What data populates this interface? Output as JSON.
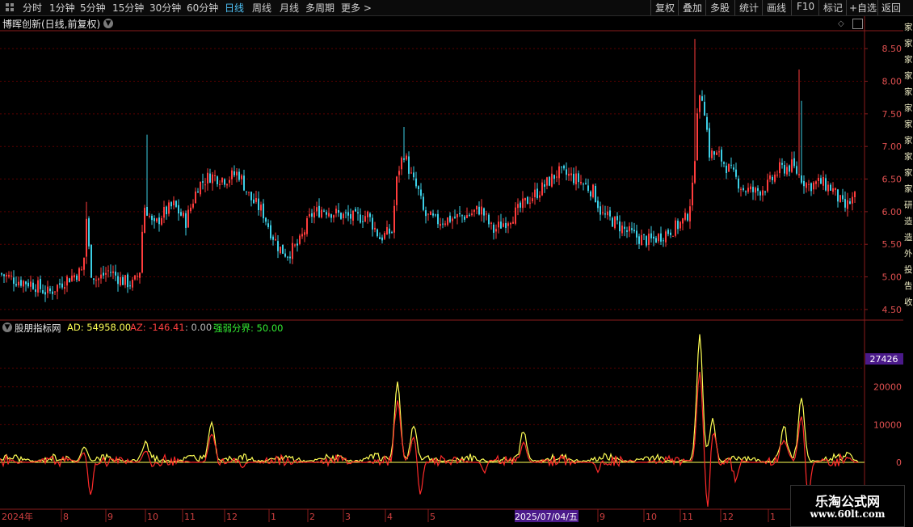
{
  "toolbar": {
    "periods": [
      "分时",
      "1分钟",
      "5分钟",
      "15分钟",
      "30分钟",
      "60分钟",
      "日线",
      "周线",
      "月线",
      "多周期",
      "更多 >"
    ],
    "active_period": "日线",
    "right_tools": [
      "复权",
      "叠加",
      "多股",
      "统计",
      "画线",
      "F10",
      "标记",
      "+自选",
      "返回"
    ]
  },
  "main_chart": {
    "title": "博晖创新(日线,前复权)",
    "price_axis_ticks": [
      "8.50",
      "8.00",
      "7.50",
      "7.00",
      "6.50",
      "6.00",
      "5.50",
      "5.00",
      "4.50"
    ]
  },
  "indicator": {
    "name": "股朋指标网",
    "ad_text": "AD: 54958.00",
    "az_text": "AZ: -146.41",
    "zero_text": ": 0.00",
    "qr_text": "强弱分界: 50.00",
    "axis_ticks": [
      "20000",
      "10000",
      "0"
    ],
    "highlight_value": "27426"
  },
  "date_axis": {
    "year_label": "2024年",
    "months": [
      "8",
      "9",
      "10",
      "11",
      "12",
      "1",
      "2",
      "3",
      "4",
      "5",
      "9",
      "10",
      "11",
      "12",
      "1"
    ],
    "cursor_date": "2025/07/04/五"
  },
  "right_side_text": "家家家家家家家家家家家研造造外投告收",
  "watermark": {
    "line1": "乐淘公式网",
    "line2": "www.60lt.com"
  },
  "colors": {
    "up": "#ff3c3c",
    "down": "#3ccfe6",
    "ad": "#ffff55",
    "az": "#ff2a2a",
    "grid": "#5a0000",
    "axis": "#8a1c1c"
  },
  "chart_data": {
    "type": "candlestick",
    "price_ylim": [
      4.35,
      8.75
    ],
    "price_trend": [
      [
        0,
        5.05
      ],
      [
        20,
        4.95
      ],
      [
        40,
        4.9
      ],
      [
        60,
        4.75
      ],
      [
        80,
        4.95
      ],
      [
        95,
        5.05
      ],
      [
        103,
        5.1
      ],
      [
        107,
        5.9
      ],
      [
        112,
        5.1
      ],
      [
        120,
        4.95
      ],
      [
        135,
        5.1
      ],
      [
        150,
        4.95
      ],
      [
        165,
        4.88
      ],
      [
        173,
        5.1
      ],
      [
        178,
        6.1
      ],
      [
        183,
        6.0
      ],
      [
        190,
        5.75
      ],
      [
        200,
        5.95
      ],
      [
        215,
        6.1
      ],
      [
        230,
        5.85
      ],
      [
        245,
        6.4
      ],
      [
        260,
        6.55
      ],
      [
        280,
        6.5
      ],
      [
        295,
        6.6
      ],
      [
        310,
        6.2
      ],
      [
        325,
        6.0
      ],
      [
        335,
        5.7
      ],
      [
        345,
        5.45
      ],
      [
        355,
        5.35
      ],
      [
        370,
        5.5
      ],
      [
        385,
        5.95
      ],
      [
        400,
        6.05
      ],
      [
        420,
        5.95
      ],
      [
        440,
        5.9
      ],
      [
        455,
        5.95
      ],
      [
        470,
        5.6
      ],
      [
        485,
        5.7
      ],
      [
        492,
        6.6
      ],
      [
        500,
        6.9
      ],
      [
        510,
        6.5
      ],
      [
        518,
        6.3
      ],
      [
        525,
        5.95
      ],
      [
        540,
        5.85
      ],
      [
        560,
        5.9
      ],
      [
        580,
        5.95
      ],
      [
        595,
        6.05
      ],
      [
        610,
        5.7
      ],
      [
        625,
        5.85
      ],
      [
        640,
        6.0
      ],
      [
        655,
        6.2
      ],
      [
        670,
        6.35
      ],
      [
        690,
        6.6
      ],
      [
        705,
        6.55
      ],
      [
        720,
        6.45
      ],
      [
        735,
        6.3
      ],
      [
        745,
        5.95
      ],
      [
        760,
        5.85
      ],
      [
        775,
        5.7
      ],
      [
        790,
        5.6
      ],
      [
        805,
        5.55
      ],
      [
        820,
        5.65
      ],
      [
        835,
        5.75
      ],
      [
        850,
        5.9
      ],
      [
        858,
        6.4
      ],
      [
        863,
        7.6
      ],
      [
        870,
        7.8
      ],
      [
        878,
        6.9
      ],
      [
        890,
        6.85
      ],
      [
        905,
        6.6
      ],
      [
        920,
        6.35
      ],
      [
        935,
        6.3
      ],
      [
        950,
        6.4
      ],
      [
        965,
        6.65
      ],
      [
        980,
        6.7
      ],
      [
        990,
        6.55
      ],
      [
        1000,
        6.4
      ],
      [
        1015,
        6.45
      ],
      [
        1030,
        6.35
      ],
      [
        1045,
        6.05
      ],
      [
        1060,
        6.25
      ]
    ],
    "spikes": [
      [
        107,
        6.15
      ],
      [
        181,
        7.18
      ],
      [
        500,
        7.3
      ],
      [
        861,
        8.65
      ],
      [
        990,
        8.18
      ],
      [
        993,
        7.7
      ]
    ],
    "indicator_ylim": [
      -12000,
      33000
    ],
    "ad_peaks": [
      [
        0,
        200
      ],
      [
        104,
        3600
      ],
      [
        180,
        4000
      ],
      [
        262,
        10500
      ],
      [
        492,
        21000
      ],
      [
        512,
        9000
      ],
      [
        648,
        7000
      ],
      [
        866,
        32000
      ],
      [
        882,
        11000
      ],
      [
        970,
        8000
      ],
      [
        992,
        16500
      ],
      [
        1050,
        2000
      ]
    ],
    "az_troughs": [
      [
        112,
        -9000
      ],
      [
        190,
        -1500
      ],
      [
        300,
        -1300
      ],
      [
        520,
        -9000
      ],
      [
        600,
        -3000
      ],
      [
        740,
        -2500
      ],
      [
        876,
        -14000
      ],
      [
        910,
        -5000
      ],
      [
        1000,
        -10000
      ]
    ]
  }
}
